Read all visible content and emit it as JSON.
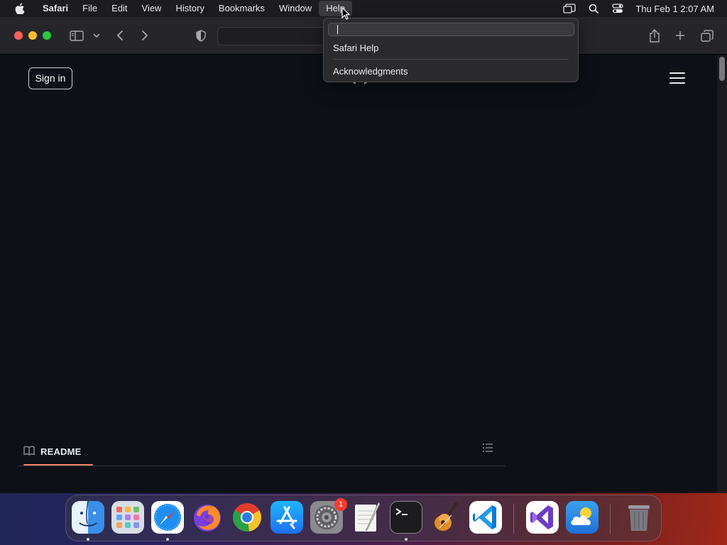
{
  "menubar": {
    "app_name": "Safari",
    "menus": [
      "File",
      "Edit",
      "View",
      "History",
      "Bookmarks",
      "Window",
      "Help"
    ],
    "active_menu": "Help",
    "clock": "Thu Feb 1  2:07 AM",
    "status_icons": [
      "screen-mirroring-icon",
      "spotlight-search-icon",
      "control-center-icon"
    ]
  },
  "help_menu": {
    "search_value": "",
    "items": [
      "Safari Help",
      "Acknowledgments"
    ]
  },
  "page": {
    "signin_label": "Sign in",
    "readme_label": "README"
  },
  "dock": {
    "apps": [
      {
        "name": "Finder",
        "icon": "finder-icon",
        "running": true
      },
      {
        "name": "Launchpad",
        "icon": "launchpad-icon",
        "running": false
      },
      {
        "name": "Safari",
        "icon": "safari-icon",
        "running": true
      },
      {
        "name": "Firefox",
        "icon": "firefox-icon",
        "running": false
      },
      {
        "name": "Google Chrome",
        "icon": "chrome-icon",
        "running": false
      },
      {
        "name": "App Store",
        "icon": "app-store-icon",
        "running": false
      },
      {
        "name": "System Settings",
        "icon": "system-settings-icon",
        "running": false,
        "badge": "1"
      },
      {
        "name": "TextEdit",
        "icon": "textedit-icon",
        "running": false
      },
      {
        "name": "Terminal",
        "icon": "terminal-icon",
        "running": true
      },
      {
        "name": "GarageBand",
        "icon": "garageband-icon",
        "running": false
      },
      {
        "name": "Visual Studio Code",
        "icon": "vscode-icon",
        "running": false
      },
      {
        "name": "Visual Studio",
        "icon": "visual-studio-icon",
        "running": false
      },
      {
        "name": "Weather",
        "icon": "weather-icon",
        "running": false
      },
      {
        "name": "Trash",
        "icon": "trash-icon",
        "running": false
      }
    ]
  },
  "colors": {
    "page_bg": "#0d1117",
    "toolbar_bg": "#26262a",
    "readme_accent": "#f78166",
    "close": "#fe5f57",
    "minimize": "#febc2e",
    "maximize": "#28c840"
  }
}
